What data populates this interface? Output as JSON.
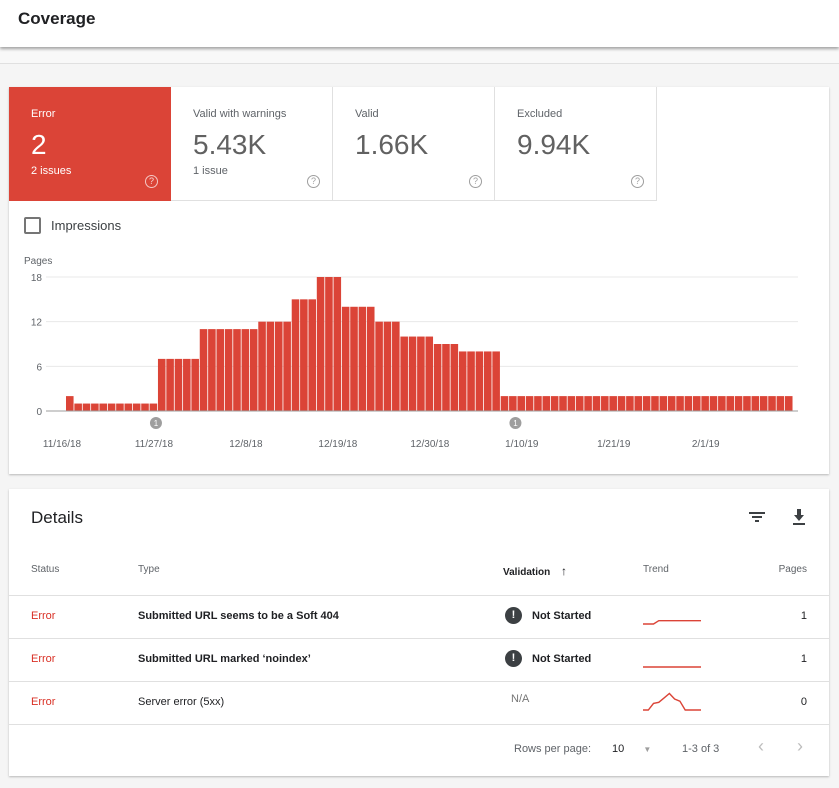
{
  "header": {
    "title": "Coverage"
  },
  "overview": {
    "tiles": [
      {
        "label": "Error",
        "value": "2",
        "sub": "2 issues",
        "active": true
      },
      {
        "label": "Valid with warnings",
        "value": "5.43K",
        "sub": "1 issue",
        "active": false
      },
      {
        "label": "Valid",
        "value": "1.66K",
        "sub": "",
        "active": false
      },
      {
        "label": "Excluded",
        "value": "9.94K",
        "sub": "",
        "active": false
      }
    ],
    "help_glyph": "?",
    "impressions_label": "Impressions",
    "impressions_checked": false
  },
  "colors": {
    "error": "#db4437",
    "error_text": "#d93025"
  },
  "chart_data": {
    "type": "bar",
    "title": "",
    "ylabel": "Pages",
    "xlabel": "",
    "ylim": [
      0,
      18
    ],
    "yticks": [
      0,
      6,
      12,
      18
    ],
    "grid": true,
    "start_date": "11/16/18",
    "xtick_labels": [
      "11/16/18",
      "11/27/18",
      "12/8/18",
      "12/19/18",
      "12/30/18",
      "1/10/19",
      "1/21/19",
      "2/1/19"
    ],
    "xtick_day_index": [
      0,
      11,
      22,
      33,
      44,
      55,
      66,
      77
    ],
    "annotations": [
      {
        "day_index": 11,
        "label": "1"
      },
      {
        "day_index": 54,
        "label": "1"
      }
    ],
    "values": [
      2,
      1,
      1,
      1,
      1,
      1,
      1,
      1,
      1,
      1,
      1,
      7,
      7,
      7,
      7,
      7,
      11,
      11,
      11,
      11,
      11,
      11,
      11,
      12,
      12,
      12,
      12,
      15,
      15,
      15,
      18,
      18,
      18,
      14,
      14,
      14,
      14,
      12,
      12,
      12,
      10,
      10,
      10,
      10,
      9,
      9,
      9,
      8,
      8,
      8,
      8,
      8,
      2,
      2,
      2,
      2,
      2,
      2,
      2,
      2,
      2,
      2,
      2,
      2,
      2,
      2,
      2,
      2,
      2,
      2,
      2,
      2,
      2,
      2,
      2,
      2,
      2,
      2,
      2,
      2,
      2,
      2,
      2,
      2,
      2,
      2,
      2
    ]
  },
  "details": {
    "title": "Details",
    "filter_icon": "filter-icon",
    "download_icon": "download-icon",
    "columns": {
      "status": "Status",
      "type": "Type",
      "validation": "Validation",
      "validation_sort": "↑",
      "trend": "Trend",
      "pages": "Pages"
    },
    "rows": [
      {
        "status": "Error",
        "type": "Submitted URL seems to be a Soft 404",
        "type_bold": true,
        "validation": "Not Started",
        "validation_icon": "!",
        "trend": [
          0,
          0,
          0,
          0.15,
          0.15,
          0.15,
          0.15,
          0.15,
          0.15,
          0.15,
          0.15,
          0.15
        ],
        "pages": "1"
      },
      {
        "status": "Error",
        "type": "Submitted URL marked ‘noindex’",
        "type_bold": true,
        "validation": "Not Started",
        "validation_icon": "!",
        "trend": [
          0,
          0,
          0,
          0,
          0,
          0,
          0,
          0,
          0,
          0,
          0,
          0
        ],
        "pages": "1"
      },
      {
        "status": "Error",
        "type": "Server error (5xx)",
        "type_bold": false,
        "validation": "N/A",
        "validation_icon": "",
        "trend": [
          0,
          0,
          0.3,
          0.35,
          0.55,
          0.75,
          0.5,
          0.4,
          0,
          0,
          0,
          0
        ],
        "pages": "0"
      }
    ],
    "footer": {
      "rows_per_page_label": "Rows per page:",
      "rows_per_page": "10",
      "range": "1-3 of 3",
      "prev": "‹",
      "next": "›"
    }
  }
}
